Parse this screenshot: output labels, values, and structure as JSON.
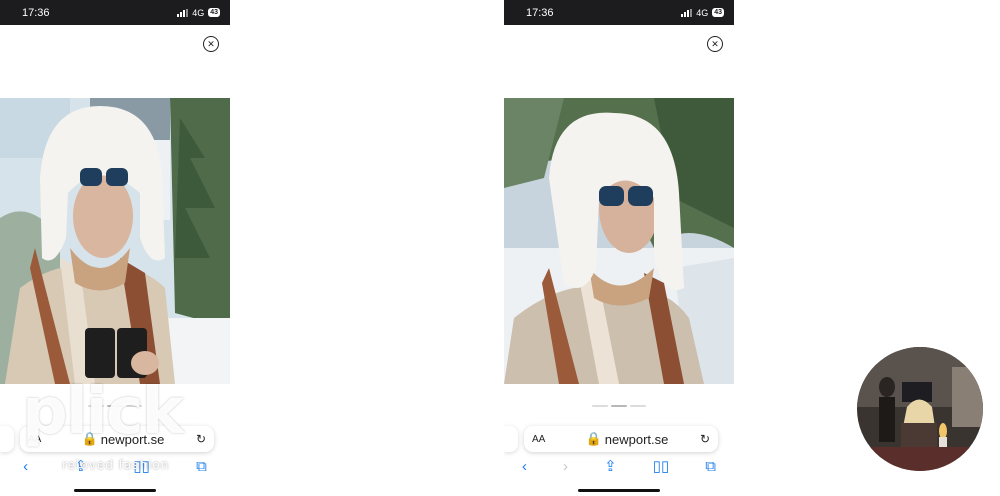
{
  "left_phone": {
    "status": {
      "time": "17:36",
      "network": "4G",
      "battery": "43"
    },
    "url_bar": {
      "text_size": "AA",
      "url": "newport.se"
    },
    "toolbar": [
      "back-icon",
      "share-icon",
      "bookmarks-icon",
      "tabs-icon"
    ]
  },
  "right_phone": {
    "status": {
      "time": "17:36",
      "network": "4G",
      "battery": "43"
    },
    "url_bar": {
      "text_size": "AA",
      "url": "newport.se"
    },
    "toolbar": [
      "back-icon",
      "forward-icon",
      "share-icon",
      "bookmarks-icon",
      "tabs-icon"
    ]
  },
  "watermark": {
    "brand": "plick",
    "tagline": "reloved fashion"
  },
  "colors": {
    "accent": "#1a7cf0",
    "status_bar": "#1c1c1e"
  }
}
